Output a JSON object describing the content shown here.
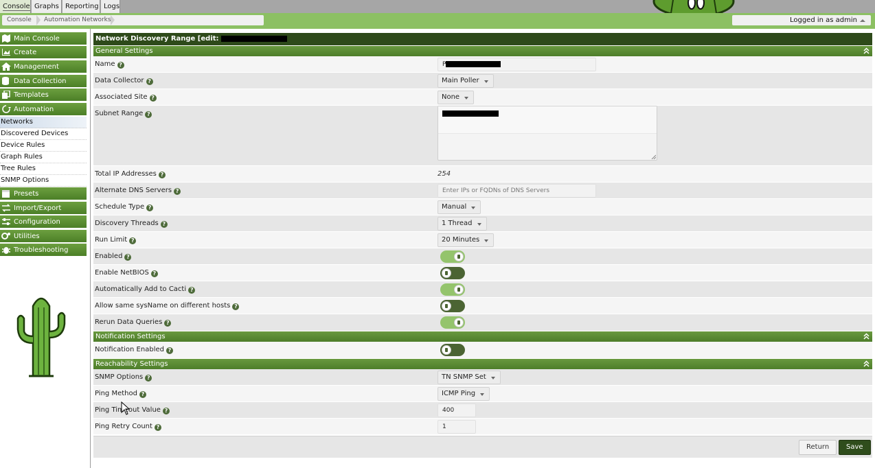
{
  "top_tabs": [
    "Console",
    "Graphs",
    "Reporting",
    "Logs"
  ],
  "breadcrumb": [
    "Console",
    "Automation Networks"
  ],
  "user": {
    "logged_in_text": "Logged in as admin"
  },
  "sidebar": {
    "main_console": "Main Console",
    "create": "Create",
    "management": "Management",
    "data_collection": "Data Collection",
    "templates": "Templates",
    "automation": "Automation",
    "automation_items": [
      "Networks",
      "Discovered Devices",
      "Device Rules",
      "Graph Rules",
      "Tree Rules",
      "SNMP Options"
    ],
    "presets": "Presets",
    "import_export": "Import/Export",
    "configuration": "Configuration",
    "utilities": "Utilities",
    "troubleshooting": "Troubleshooting"
  },
  "page": {
    "title": "Network Discovery Range [edit: "
  },
  "sections": {
    "general": "General Settings",
    "notification": "Notification Settings",
    "reachability": "Reachability Settings"
  },
  "general": {
    "name": {
      "label": "Name",
      "value": "P"
    },
    "data_collector": {
      "label": "Data Collector",
      "value": "Main Poller"
    },
    "associated_site": {
      "label": "Associated Site",
      "value": "None"
    },
    "subnet_range": {
      "label": "Subnet Range"
    },
    "total_ip": {
      "label": "Total IP Addresses",
      "value": "254"
    },
    "alt_dns": {
      "label": "Alternate DNS Servers",
      "placeholder": "Enter IPs or FQDNs of DNS Servers"
    },
    "schedule_type": {
      "label": "Schedule Type",
      "value": "Manual"
    },
    "discovery_threads": {
      "label": "Discovery Threads",
      "value": "1 Thread"
    },
    "run_limit": {
      "label": "Run Limit",
      "value": "20 Minutes"
    },
    "enabled": {
      "label": "Enabled",
      "state": "on"
    },
    "enable_netbios": {
      "label": "Enable NetBIOS",
      "state": "off"
    },
    "auto_add": {
      "label": "Automatically Add to Cacti",
      "state": "on"
    },
    "same_sysname": {
      "label": "Allow same sysName on different hosts",
      "state": "off"
    },
    "rerun_queries": {
      "label": "Rerun Data Queries",
      "state": "on"
    }
  },
  "notification": {
    "enabled": {
      "label": "Notification Enabled",
      "state": "off"
    }
  },
  "reachability": {
    "snmp_options": {
      "label": "SNMP Options",
      "value": "TN SNMP Set"
    },
    "ping_method": {
      "label": "Ping Method",
      "value": "ICMP Ping"
    },
    "ping_timeout": {
      "label": "Ping Timeout Value",
      "value": "400"
    },
    "ping_retry": {
      "label": "Ping Retry Count",
      "value": "1"
    }
  },
  "buttons": {
    "return": "Return",
    "save": "Save"
  },
  "help_glyph": "?",
  "colors": {
    "accent_green": "#5a8a33",
    "title_dark": "#2e4a1a",
    "toggle_on": "#94c46c",
    "toggle_off": "#4b6433"
  }
}
